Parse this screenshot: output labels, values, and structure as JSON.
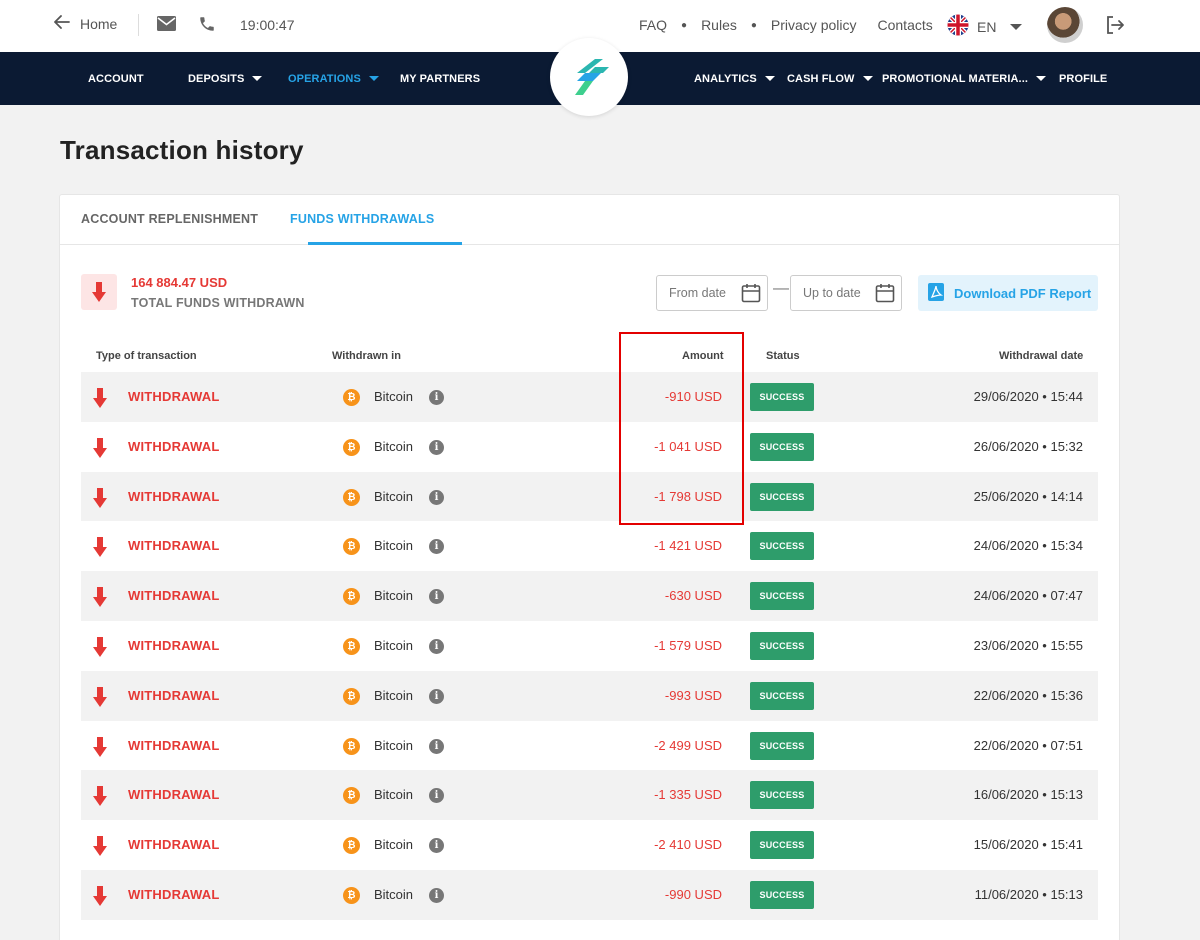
{
  "topbar": {
    "home_label": "Home",
    "time": "19:00:47",
    "links": [
      "FAQ",
      "Rules",
      "Privacy policy",
      "Contacts"
    ],
    "language": "EN"
  },
  "nav": {
    "left": [
      {
        "label": "ACCOUNT",
        "dropdown": false
      },
      {
        "label": "DEPOSITS",
        "dropdown": true
      },
      {
        "label": "OPERATIONS",
        "dropdown": true,
        "active": true
      },
      {
        "label": "MY PARTNERS",
        "dropdown": false
      }
    ],
    "right": [
      {
        "label": "ANALYTICS",
        "dropdown": true
      },
      {
        "label": "CASH FLOW",
        "dropdown": true
      },
      {
        "label": "PROMOTIONAL MATERIA...",
        "dropdown": true
      },
      {
        "label": "PROFILE",
        "dropdown": false
      }
    ]
  },
  "page": {
    "title": "Transaction history"
  },
  "tabs": [
    {
      "label": "ACCOUNT REPLENISHMENT",
      "active": false
    },
    {
      "label": "FUNDS WITHDRAWALS",
      "active": true
    }
  ],
  "summary": {
    "amount": "164 884.47 USD",
    "label": "TOTAL FUNDS WITHDRAWN"
  },
  "filters": {
    "from_placeholder": "From date",
    "to_placeholder": "Up to date",
    "download_label": "Download PDF Report"
  },
  "table": {
    "headers": {
      "type": "Type of transaction",
      "withdrawn_in": "Withdrawn in",
      "amount": "Amount",
      "status": "Status",
      "date": "Withdrawal date"
    },
    "rows": [
      {
        "type": "WITHDRAWAL",
        "currency": "Bitcoin",
        "amount": "-910 USD",
        "status": "SUCCESS",
        "date": "29/06/2020 • 15:44"
      },
      {
        "type": "WITHDRAWAL",
        "currency": "Bitcoin",
        "amount": "-1 041 USD",
        "status": "SUCCESS",
        "date": "26/06/2020 • 15:32"
      },
      {
        "type": "WITHDRAWAL",
        "currency": "Bitcoin",
        "amount": "-1 798 USD",
        "status": "SUCCESS",
        "date": "25/06/2020 • 14:14"
      },
      {
        "type": "WITHDRAWAL",
        "currency": "Bitcoin",
        "amount": "-1 421 USD",
        "status": "SUCCESS",
        "date": "24/06/2020 • 15:34"
      },
      {
        "type": "WITHDRAWAL",
        "currency": "Bitcoin",
        "amount": "-630 USD",
        "status": "SUCCESS",
        "date": "24/06/2020 • 07:47"
      },
      {
        "type": "WITHDRAWAL",
        "currency": "Bitcoin",
        "amount": "-1 579 USD",
        "status": "SUCCESS",
        "date": "23/06/2020 • 15:55"
      },
      {
        "type": "WITHDRAWAL",
        "currency": "Bitcoin",
        "amount": "-993 USD",
        "status": "SUCCESS",
        "date": "22/06/2020 • 15:36"
      },
      {
        "type": "WITHDRAWAL",
        "currency": "Bitcoin",
        "amount": "-2 499 USD",
        "status": "SUCCESS",
        "date": "22/06/2020 • 07:51"
      },
      {
        "type": "WITHDRAWAL",
        "currency": "Bitcoin",
        "amount": "-1 335 USD",
        "status": "SUCCESS",
        "date": "16/06/2020 • 15:13"
      },
      {
        "type": "WITHDRAWAL",
        "currency": "Bitcoin",
        "amount": "-2 410 USD",
        "status": "SUCCESS",
        "date": "15/06/2020 • 15:41"
      },
      {
        "type": "WITHDRAWAL",
        "currency": "Bitcoin",
        "amount": "-990 USD",
        "status": "SUCCESS",
        "date": "11/06/2020 • 15:13"
      }
    ]
  },
  "colors": {
    "nav_bg": "#0b1a33",
    "accent": "#26a3e6",
    "negative": "#e53935",
    "success": "#2e9d6b",
    "bitcoin": "#f7931a",
    "annotation_box": "#e30000"
  },
  "icons": [
    "arrow-left-icon",
    "mail-icon",
    "phone-icon",
    "uk-flag-icon",
    "logout-icon",
    "calendar-icon",
    "pdf-icon",
    "down-arrow-icon",
    "bitcoin-icon",
    "info-icon"
  ]
}
